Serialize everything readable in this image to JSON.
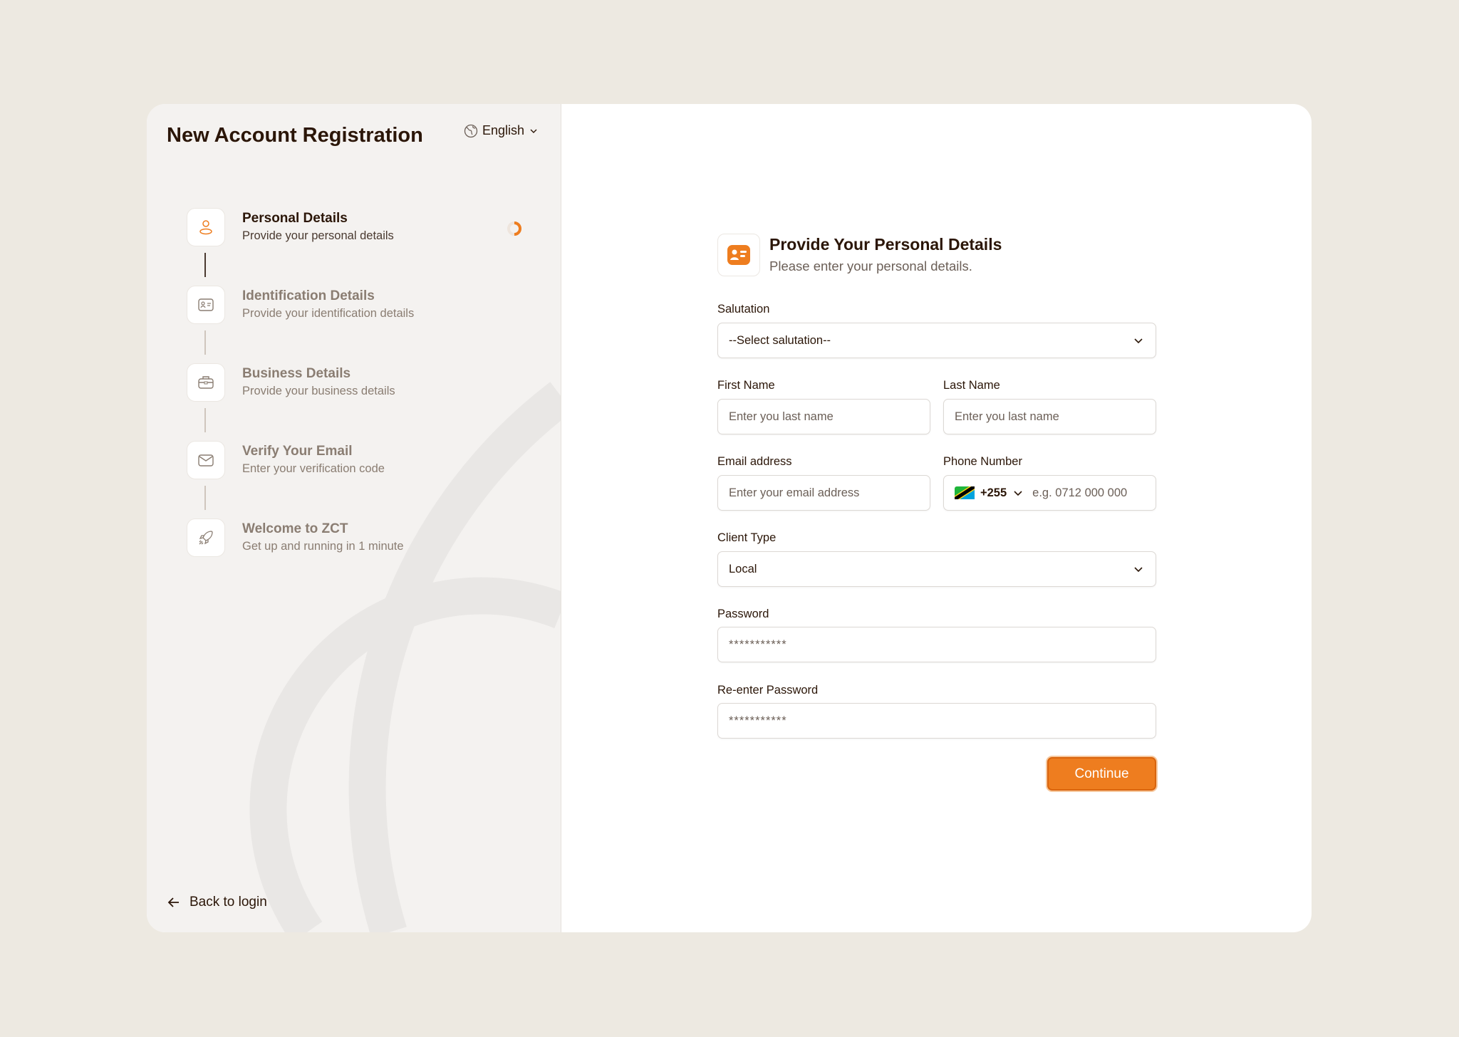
{
  "sidebar": {
    "title": "New Account Registration",
    "language": "English",
    "steps": [
      {
        "title": "Personal Details",
        "subtitle": "Provide your personal details"
      },
      {
        "title": "Identification Details",
        "subtitle": "Provide your identification details"
      },
      {
        "title": "Business Details",
        "subtitle": "Provide your business details"
      },
      {
        "title": "Verify Your Email",
        "subtitle": "Enter your verification code"
      },
      {
        "title": "Welcome to ZCT",
        "subtitle": "Get up and running in 1 minute"
      }
    ],
    "back": "Back to login"
  },
  "form": {
    "heading": "Provide Your Personal Details",
    "subheading": "Please enter your personal details.",
    "salutation": {
      "label": "Salutation",
      "value": "--Select salutation--"
    },
    "first_name": {
      "label": "First Name",
      "placeholder": "Enter you last name"
    },
    "last_name": {
      "label": "Last Name",
      "placeholder": "Enter you last name"
    },
    "email": {
      "label": "Email address",
      "placeholder": "Enter your email address"
    },
    "phone": {
      "label": "Phone Number",
      "code": "+255",
      "placeholder": "e.g. 0712 000 000"
    },
    "client_type": {
      "label": "Client Type",
      "value": "Local"
    },
    "password": {
      "label": "Password",
      "value": "***********"
    },
    "repassword": {
      "label": "Re-enter Password",
      "value": "***********"
    },
    "continue": "Continue"
  },
  "colors": {
    "accent": "#ee7d1f",
    "text": "#2b1608"
  }
}
